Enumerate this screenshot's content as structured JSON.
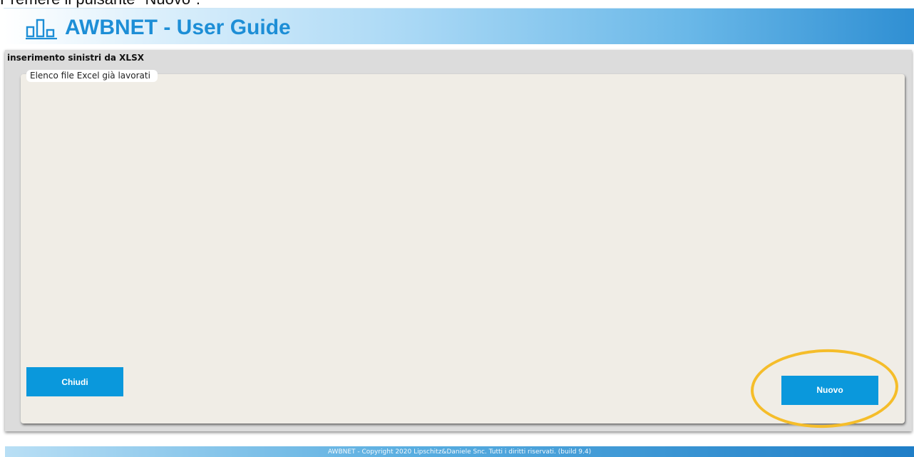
{
  "instruction_text": "Premere il pulsante \"Nuovo\".",
  "header": {
    "title": "AWBNET - User Guide",
    "logo_icon": "bar-chart-logo-icon"
  },
  "window": {
    "title": "inserimento sinistri da XLSX",
    "panel": {
      "legend": "Elenco file Excel già lavorati"
    },
    "buttons": {
      "close_label": "Chiudi",
      "new_label": "Nuovo"
    }
  },
  "footer": {
    "text": "AWBNET - Copyright 2020 Lipschitz&Daniele Snc. Tutti i diritti riservati. (build 9.4)"
  },
  "colors": {
    "accent_blue": "#0a98dc",
    "title_blue": "#1d8ed6",
    "highlight_yellow": "#f5bd2a",
    "panel_bg": "#f0ede6",
    "window_bg": "#dcdcdc"
  }
}
